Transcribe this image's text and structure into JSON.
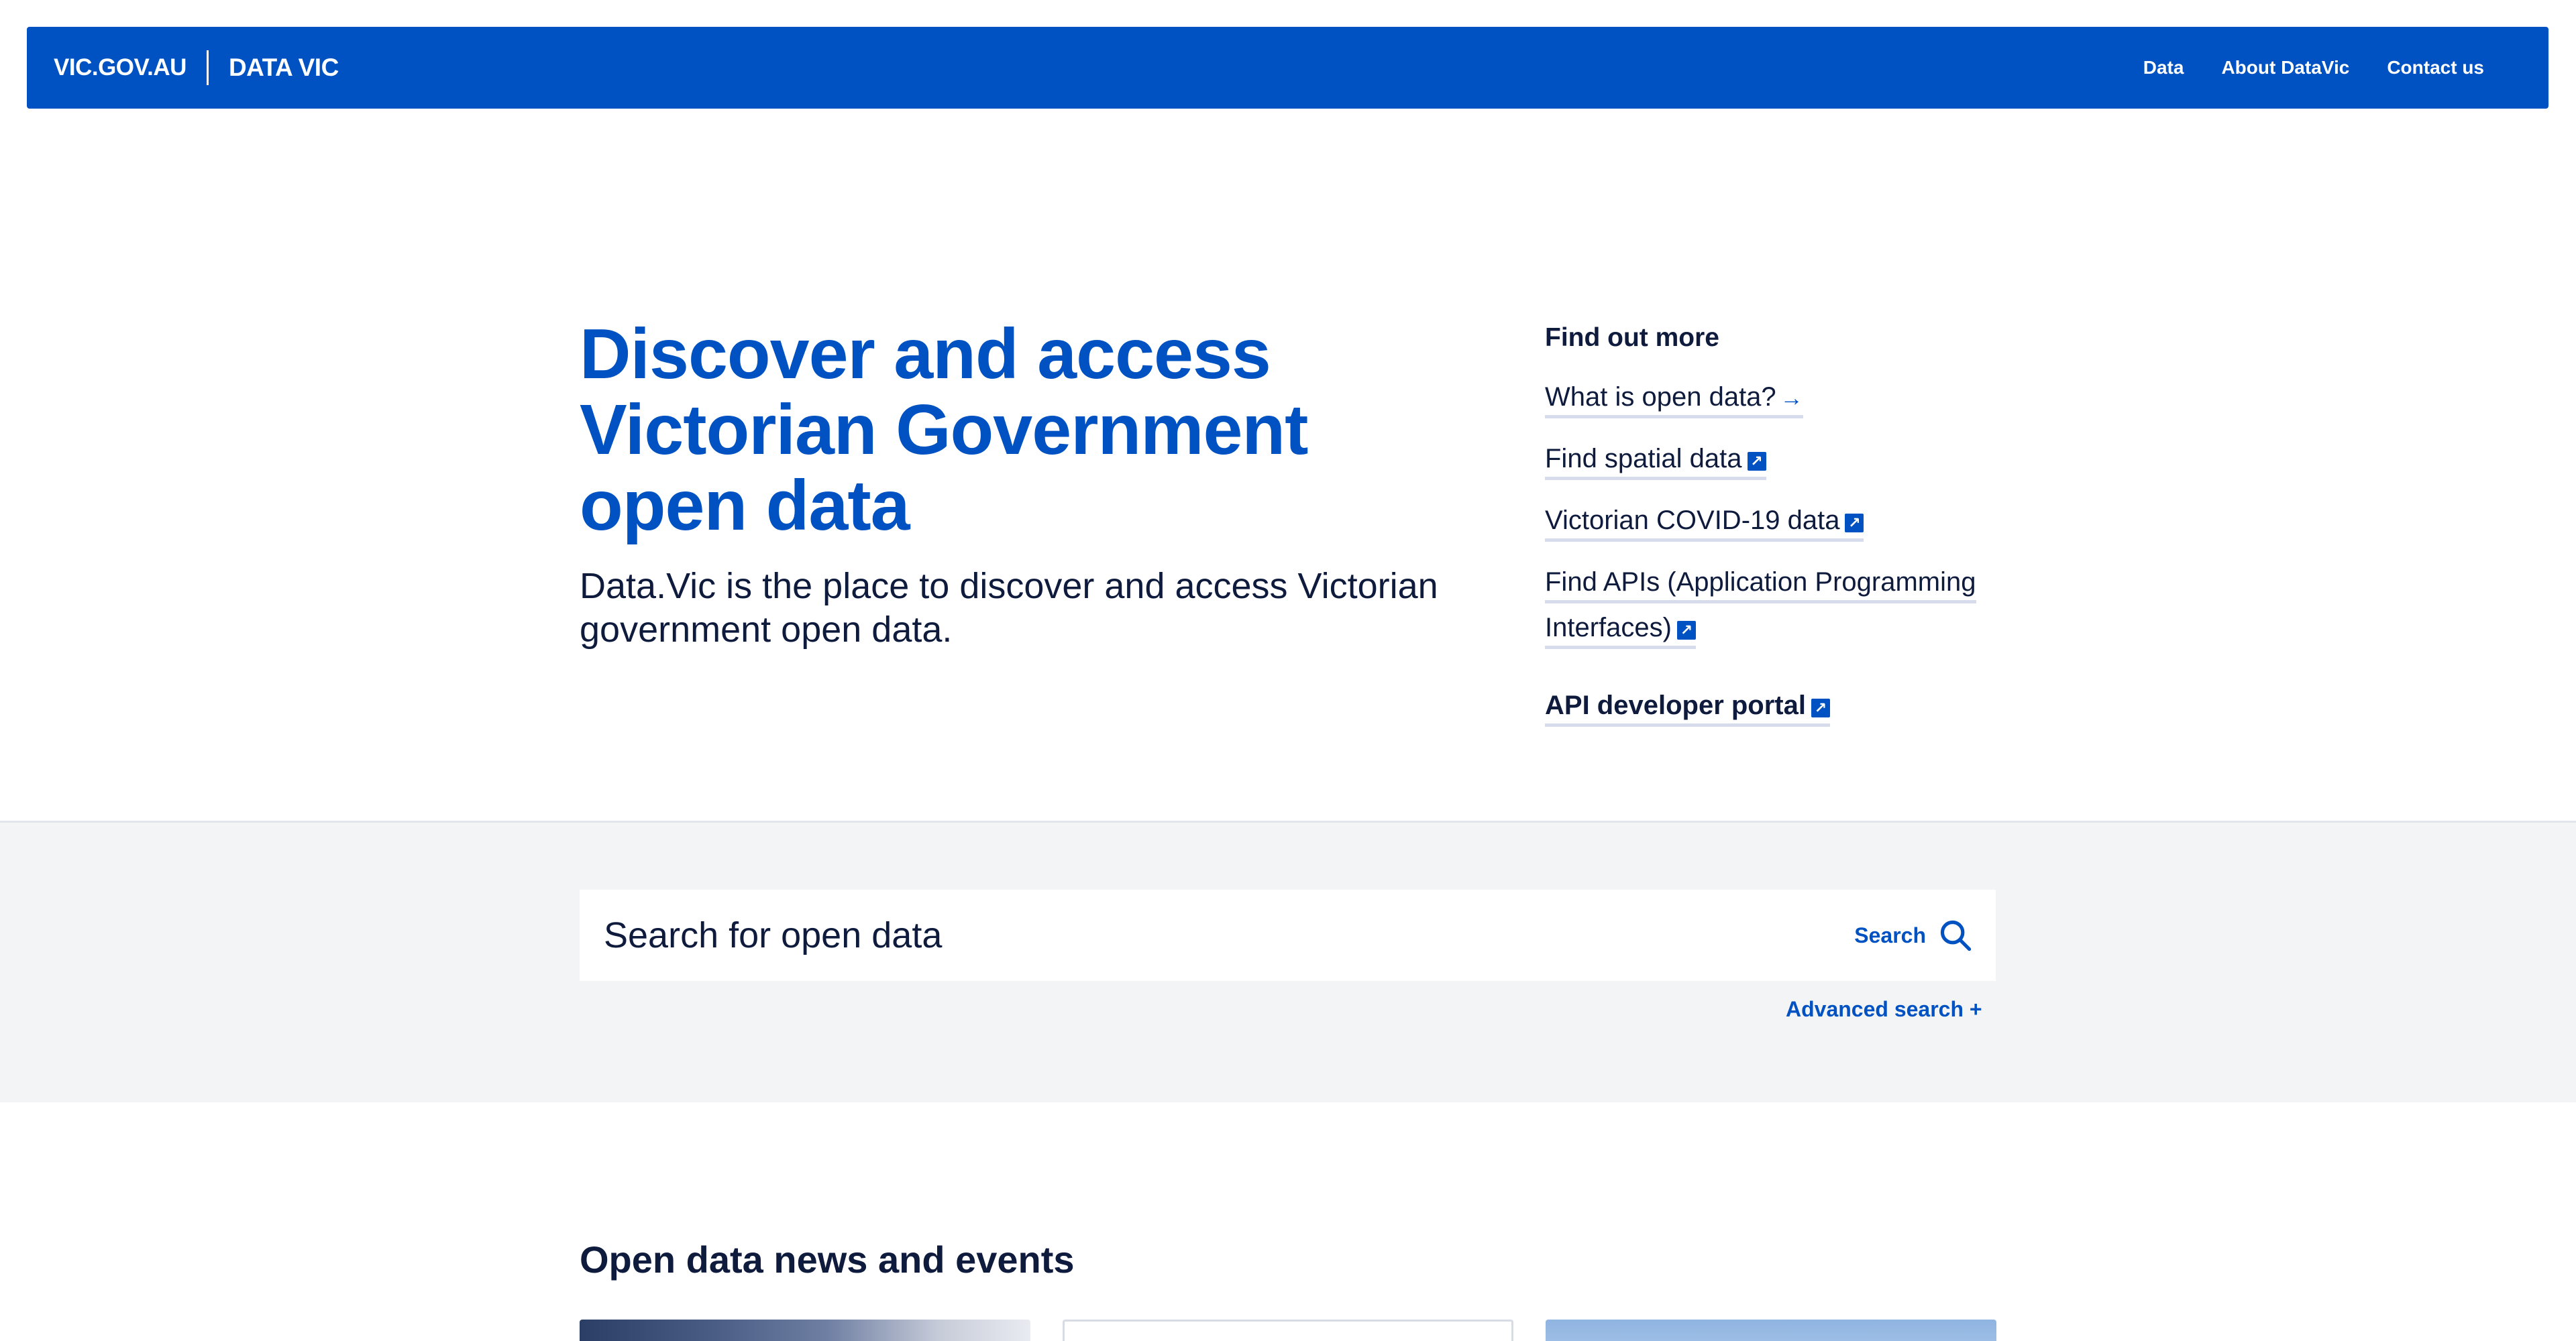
{
  "header": {
    "site": "VIC.GOV.AU",
    "product": "DATA VIC",
    "nav": [
      "Data",
      "About DataVic",
      "Contact us"
    ]
  },
  "hero": {
    "title": "Discover and access Victorian Government open data",
    "intro": "Data.Vic is the place to discover and access Victorian government open data."
  },
  "find_out_more": {
    "title": "Find out more",
    "links": [
      {
        "label": "What is open data?",
        "icon": "arrow-right-icon"
      },
      {
        "label": "Find spatial data",
        "icon": "external-link-icon"
      },
      {
        "label": "Victorian COVID-19 data",
        "icon": "external-link-icon"
      },
      {
        "label": "Find APIs (Application Programming Interfaces)",
        "icon": "external-link-icon"
      },
      {
        "label": "API developer portal",
        "icon": "external-link-icon"
      }
    ]
  },
  "search": {
    "placeholder": "Search for open data",
    "button_label": "Search",
    "advanced_label": "Advanced search +"
  },
  "news": {
    "title": "Open data news and events"
  },
  "colors": {
    "brand_blue": "#0052c2",
    "text_dark": "#0e1b3d",
    "search_band_bg": "#f3f4f6"
  }
}
